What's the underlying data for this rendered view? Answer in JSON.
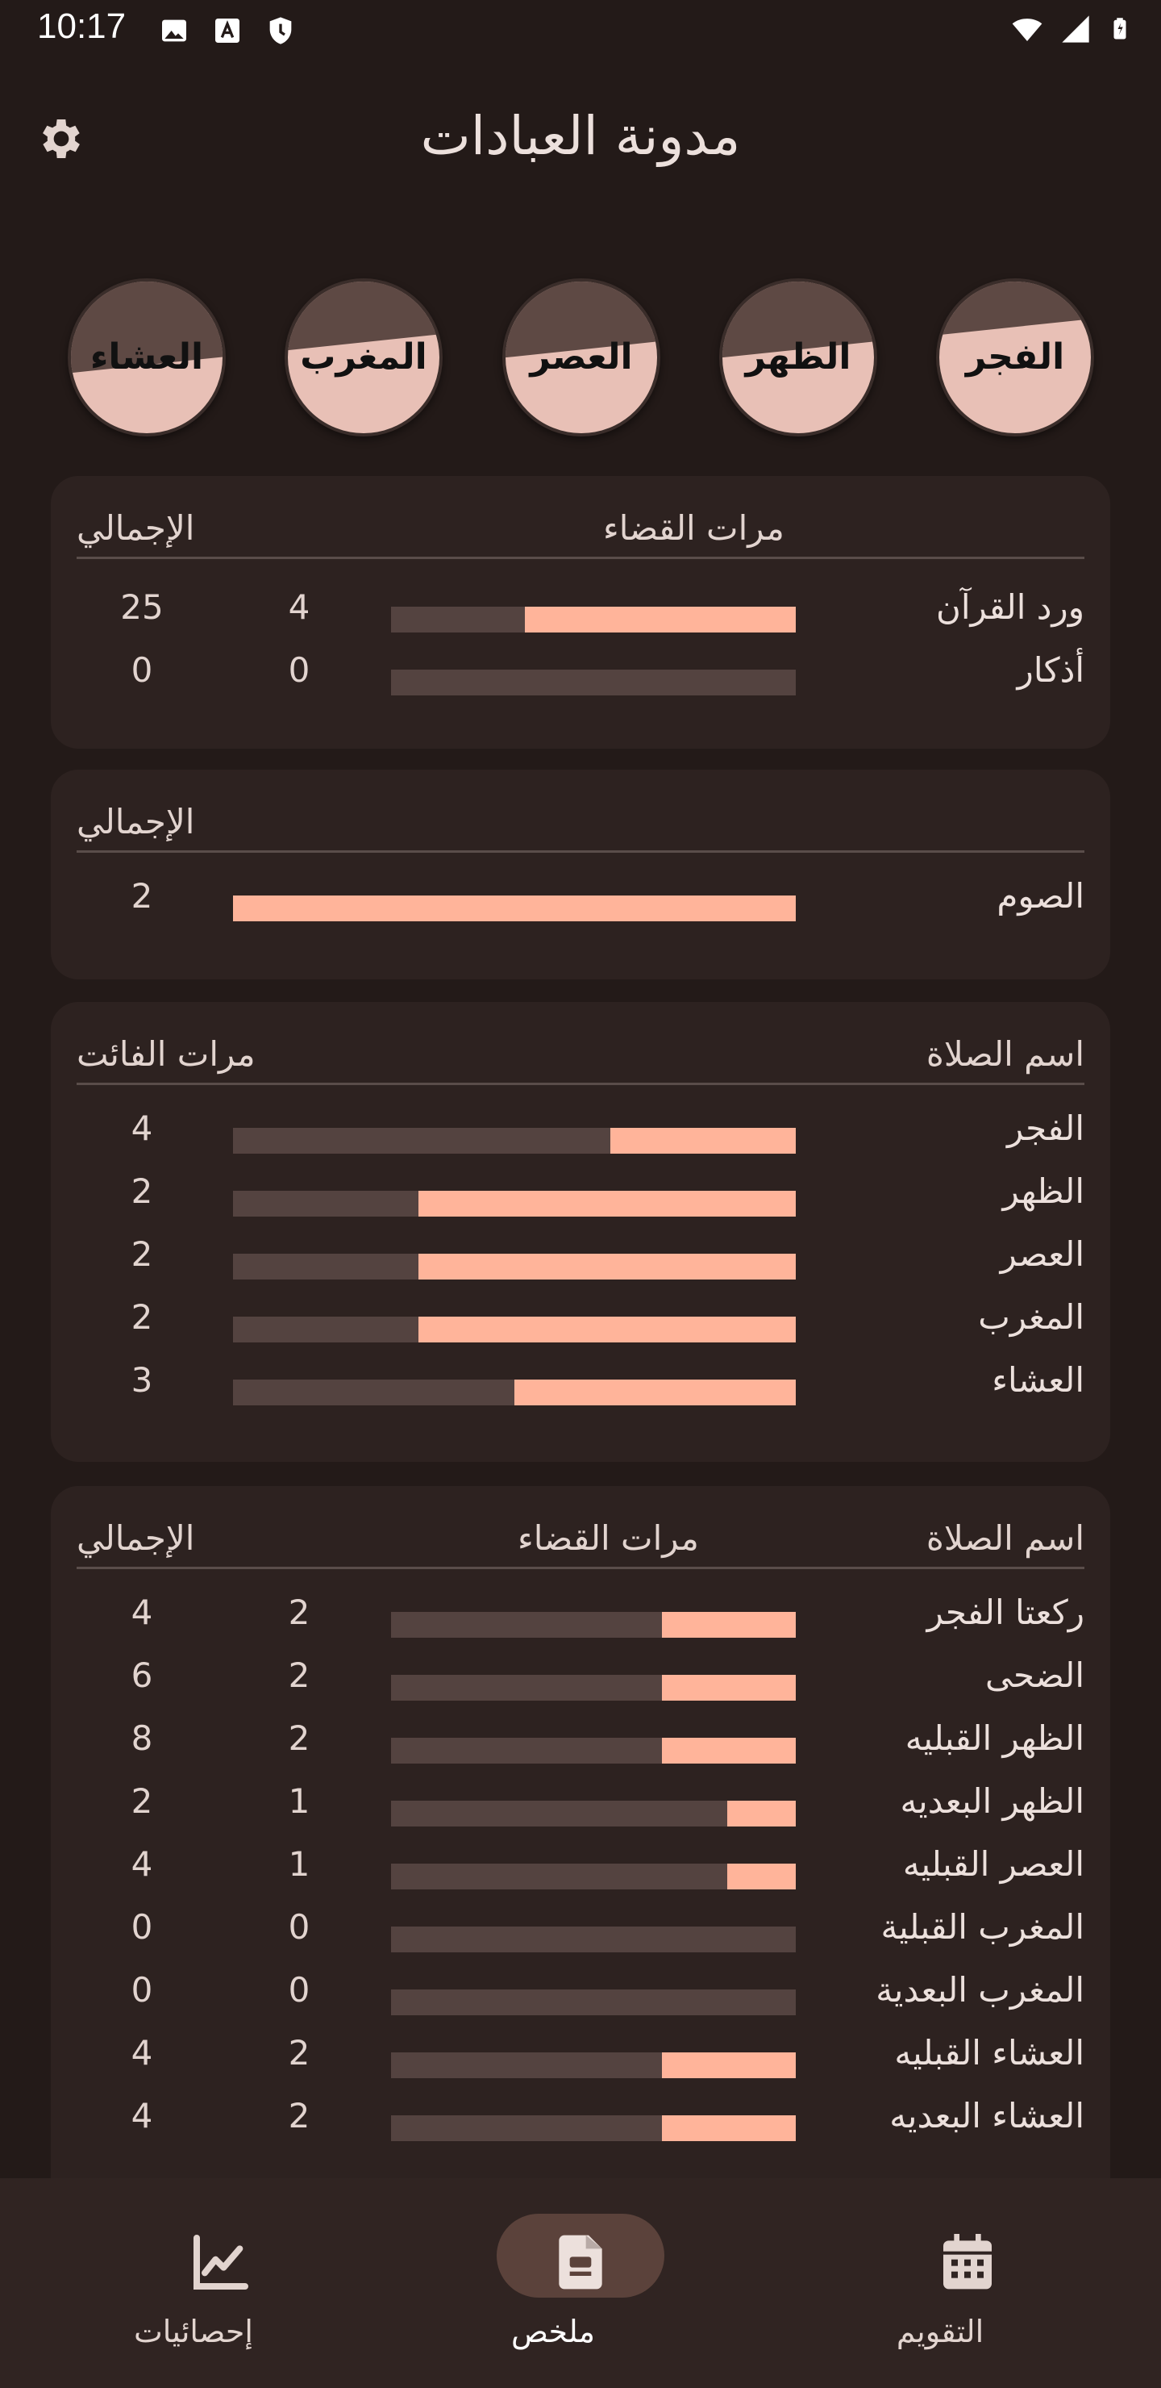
{
  "status_bar": {
    "time": "10:17"
  },
  "header": {
    "title": "مدونة العبادات"
  },
  "prayer_circles": [
    {
      "name": "الفجر",
      "fill": 0.7
    },
    {
      "name": "الظهر",
      "fill": 0.55
    },
    {
      "name": "العصر",
      "fill": 0.55
    },
    {
      "name": "المغرب",
      "fill": 0.6
    },
    {
      "name": "العشاء",
      "fill": 0.45
    }
  ],
  "quran_card": {
    "header_qada": "مرات القضاء",
    "header_total": "الإجمالي",
    "rows": [
      {
        "label": "ورد القرآن",
        "qada": "4",
        "total": "25",
        "fraction": 0.67
      },
      {
        "label": "أذكار",
        "qada": "0",
        "total": "0",
        "fraction": 0
      }
    ]
  },
  "fasting_card": {
    "header_total": "الإجمالي",
    "rows": [
      {
        "label": "الصوم",
        "total": "2",
        "fraction": 1
      }
    ]
  },
  "missed_card": {
    "header_name": "اسم الصلاة",
    "header_missed": "مرات الفائت",
    "rows": [
      {
        "label": "الفجر",
        "missed": "4",
        "fraction": 0.33
      },
      {
        "label": "الظهر",
        "missed": "2",
        "fraction": 0.67
      },
      {
        "label": "العصر",
        "missed": "2",
        "fraction": 0.67
      },
      {
        "label": "المغرب",
        "missed": "2",
        "fraction": 0.67
      },
      {
        "label": "العشاء",
        "missed": "3",
        "fraction": 0.5
      }
    ]
  },
  "sunnah_card": {
    "header_name": "اسم الصلاة",
    "header_qada": "مرات القضاء",
    "header_total": "الإجمالي",
    "rows": [
      {
        "label": "ركعتا الفجر",
        "qada": "2",
        "total": "4",
        "fraction": 0.33
      },
      {
        "label": "الضحى",
        "qada": "2",
        "total": "6",
        "fraction": 0.33
      },
      {
        "label": "الظهر القبليه",
        "qada": "2",
        "total": "8",
        "fraction": 0.33
      },
      {
        "label": "الظهر البعديه",
        "qada": "1",
        "total": "2",
        "fraction": 0.17
      },
      {
        "label": "العصر القبليه",
        "qada": "1",
        "total": "4",
        "fraction": 0.17
      },
      {
        "label": "المغرب القبلية",
        "qada": "0",
        "total": "0",
        "fraction": 0
      },
      {
        "label": "المغرب البعدية",
        "qada": "0",
        "total": "0",
        "fraction": 0
      },
      {
        "label": "العشاء القبليه",
        "qada": "2",
        "total": "4",
        "fraction": 0.33
      },
      {
        "label": "العشاء البعديه",
        "qada": "2",
        "total": "4",
        "fraction": 0.33
      }
    ]
  },
  "bottom_nav": {
    "stats_label": "إحصائيات",
    "summary_label": "ملخص",
    "calendar_label": "التقويم"
  },
  "colors": {
    "background": "#231a18",
    "card": "#2d2220",
    "accent": "#ffb49a",
    "track": "#544340"
  }
}
